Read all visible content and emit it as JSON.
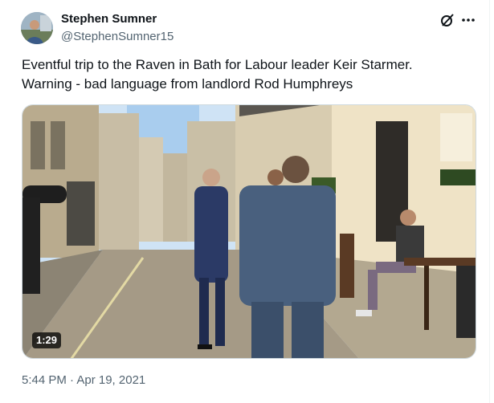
{
  "author": {
    "display_name": "Stephen Sumner",
    "handle": "@StephenSumner15",
    "avatar_icon": "user-avatar"
  },
  "header_icons": {
    "grok": "grok-icon",
    "more": "more-dots-icon"
  },
  "tweet": {
    "text_lines": [
      "Eventful trip to the Raven in Bath for Labour leader Keir Starmer.",
      "Warning - bad language from landlord Rod Humphreys"
    ]
  },
  "media": {
    "duration": "1:29"
  },
  "timestamp": "5:44 PM · Apr 19, 2021",
  "colors": {
    "text_primary": "#0f1419",
    "text_secondary": "#536471",
    "border": "#cfd9de"
  }
}
